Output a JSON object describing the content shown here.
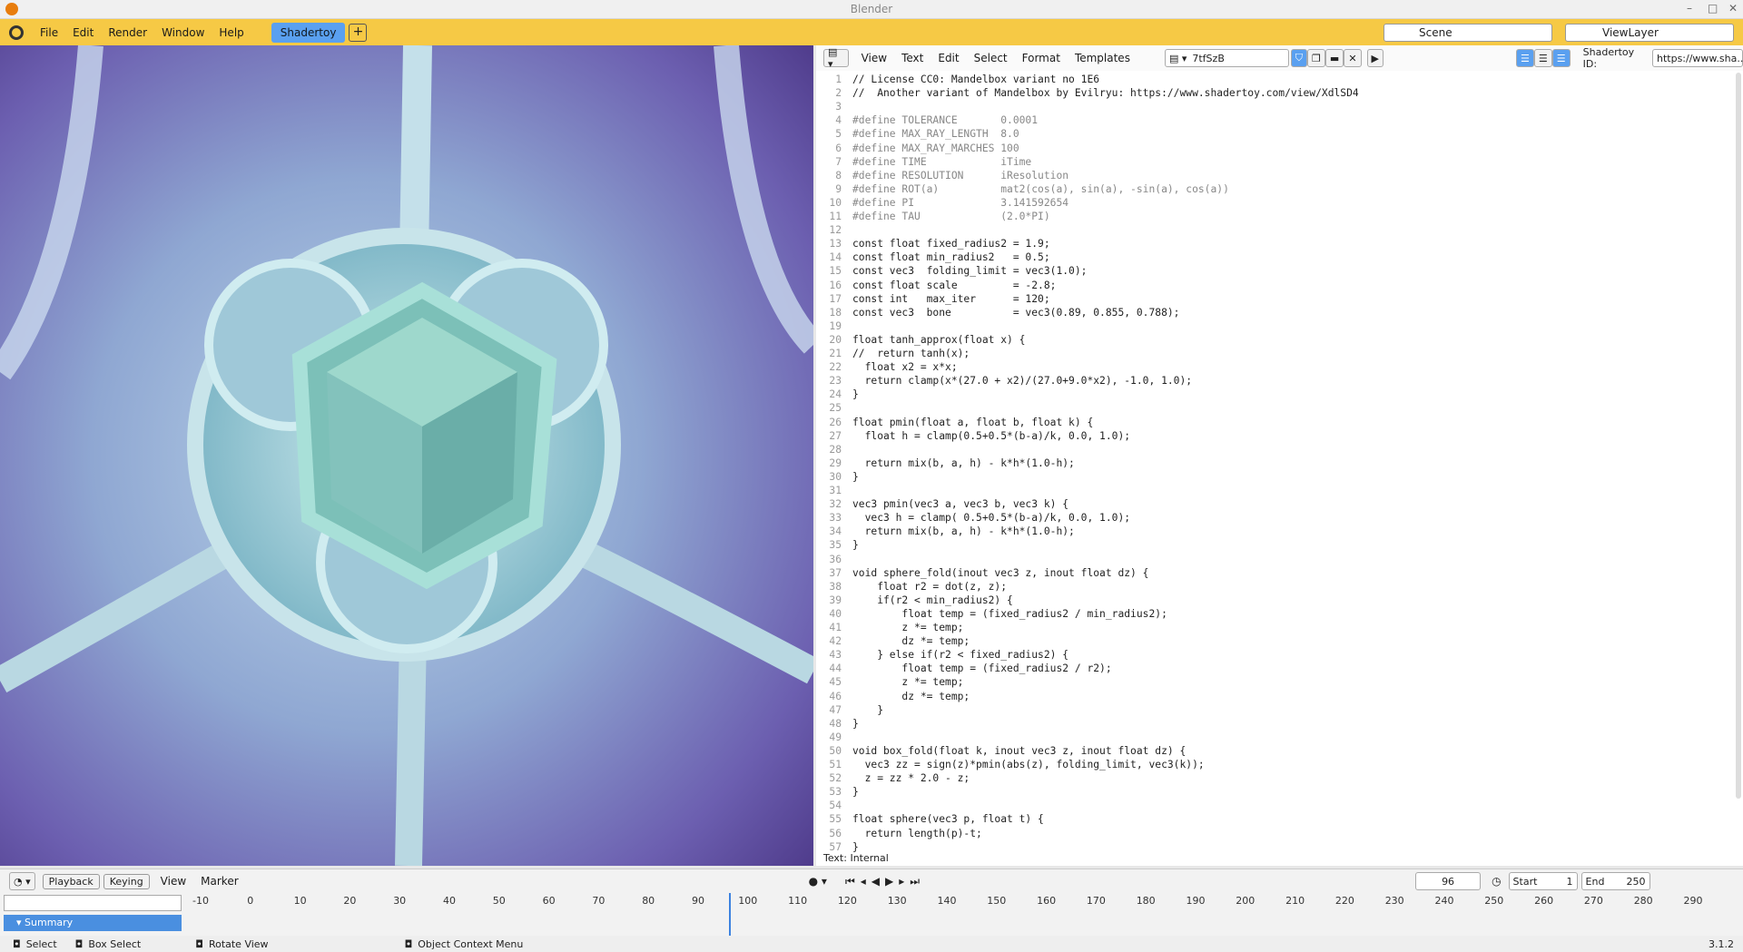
{
  "window": {
    "title": "Blender"
  },
  "menu": {
    "items": [
      "File",
      "Edit",
      "Render",
      "Window",
      "Help"
    ],
    "workspace": "Shadertoy",
    "add": "+"
  },
  "scene": {
    "name": "Scene",
    "view_layer": "ViewLayer"
  },
  "text_editor": {
    "menus": [
      "View",
      "Text",
      "Edit",
      "Select",
      "Format",
      "Templates"
    ],
    "file_name": "7tfSzB",
    "shadertoy_label": "Shadertoy ID:",
    "shadertoy_url": "https://www.sha...",
    "status": "Text: Internal"
  },
  "code_lines": [
    "// License CC0: Mandelbox variant no 1E6",
    "//  Another variant of Mandelbox by Evilryu: https://www.shadertoy.com/view/XdlSD4",
    "",
    "#define TOLERANCE       0.0001",
    "#define MAX_RAY_LENGTH  8.0",
    "#define MAX_RAY_MARCHES 100",
    "#define TIME            iTime",
    "#define RESOLUTION      iResolution",
    "#define ROT(a)          mat2(cos(a), sin(a), -sin(a), cos(a))",
    "#define PI              3.141592654",
    "#define TAU             (2.0*PI)",
    "",
    "const float fixed_radius2 = 1.9;",
    "const float min_radius2   = 0.5;",
    "const vec3  folding_limit = vec3(1.0);",
    "const float scale         = -2.8;",
    "const int   max_iter      = 120;",
    "const vec3  bone          = vec3(0.89, 0.855, 0.788);",
    "",
    "float tanh_approx(float x) {",
    "//  return tanh(x);",
    "  float x2 = x*x;",
    "  return clamp(x*(27.0 + x2)/(27.0+9.0*x2), -1.0, 1.0);",
    "}",
    "",
    "float pmin(float a, float b, float k) {",
    "  float h = clamp(0.5+0.5*(b-a)/k, 0.0, 1.0);",
    "",
    "  return mix(b, a, h) - k*h*(1.0-h);",
    "}",
    "",
    "vec3 pmin(vec3 a, vec3 b, vec3 k) {",
    "  vec3 h = clamp( 0.5+0.5*(b-a)/k, 0.0, 1.0);",
    "  return mix(b, a, h) - k*h*(1.0-h);",
    "}",
    "",
    "void sphere_fold(inout vec3 z, inout float dz) {",
    "    float r2 = dot(z, z);",
    "    if(r2 < min_radius2) {",
    "        float temp = (fixed_radius2 / min_radius2);",
    "        z *= temp;",
    "        dz *= temp;",
    "    } else if(r2 < fixed_radius2) {",
    "        float temp = (fixed_radius2 / r2);",
    "        z *= temp;",
    "        dz *= temp;",
    "    }",
    "}",
    "",
    "void box_fold(float k, inout vec3 z, inout float dz) {",
    "  vec3 zz = sign(z)*pmin(abs(z), folding_limit, vec3(k));",
    "  z = zz * 2.0 - z;",
    "}",
    "",
    "float sphere(vec3 p, float t) {",
    "  return length(p)-t;",
    "}"
  ],
  "timeline": {
    "menus": [
      "Playback",
      "Keying",
      "View",
      "Marker"
    ],
    "current_frame": "96",
    "start_label": "Start",
    "start": "1",
    "end_label": "End",
    "end": "250",
    "ruler": [
      "-10",
      "0",
      "10",
      "20",
      "30",
      "40",
      "50",
      "60",
      "70",
      "80",
      "90",
      "100",
      "110",
      "120",
      "130",
      "140",
      "150",
      "160",
      "170",
      "180",
      "190",
      "200",
      "210",
      "220",
      "230",
      "240",
      "250",
      "260",
      "270",
      "280",
      "290"
    ],
    "summary": "Summary"
  },
  "statusbar": {
    "select": "Select",
    "box_select": "Box Select",
    "rotate": "Rotate View",
    "context": "Object Context Menu",
    "version": "3.1.2"
  }
}
